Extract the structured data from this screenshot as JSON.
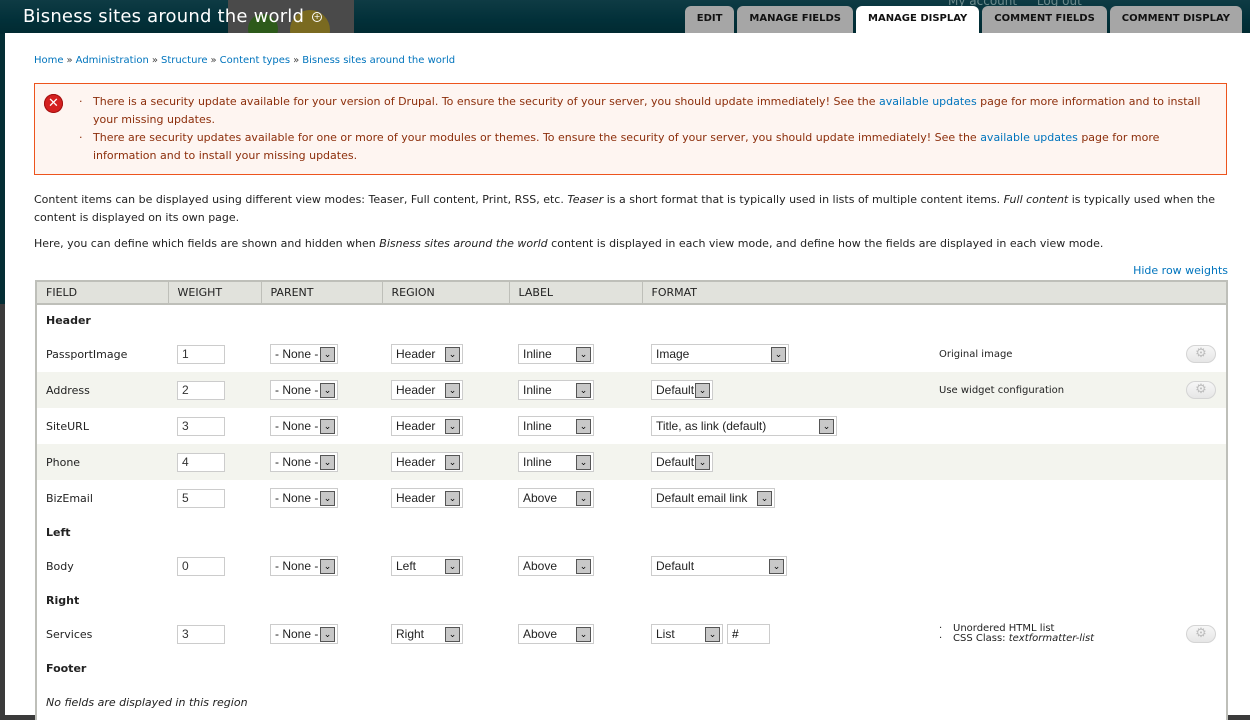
{
  "header": {
    "site_title": "Bisness sites around the world",
    "add_shortcut_icon": "plus-circle-icon",
    "account_links": [
      "My account",
      "Log out"
    ],
    "tabs": [
      {
        "label": "Edit",
        "active": false
      },
      {
        "label": "Manage fields",
        "active": false
      },
      {
        "label": "Manage display",
        "active": true
      },
      {
        "label": "Comment fields",
        "active": false
      },
      {
        "label": "Comment display",
        "active": false
      }
    ]
  },
  "breadcrumb": [
    "Home",
    "Administration",
    "Structure",
    "Content types",
    "Bisness sites around the world"
  ],
  "breadcrumb_sep": "»",
  "messages": {
    "icon": "error-icon",
    "items": [
      {
        "before": "There is a security update available for your version of Drupal. To ensure the security of your server, you should update immediately! See the ",
        "link": "available updates",
        "after": " page for more information and to install your missing updates."
      },
      {
        "before": "There are security updates available for one or more of your modules or themes. To ensure the security of your server, you should update immediately! See the ",
        "link": "available updates",
        "after": " page for more information and to install your missing updates."
      }
    ]
  },
  "intro": {
    "p1_a": "Content items can be displayed using different view modes: Teaser, Full content, Print, RSS, etc. ",
    "p1_em1": "Teaser",
    "p1_b": " is a short format that is typically used in lists of multiple content items. ",
    "p1_em2": "Full content",
    "p1_c": " is typically used when the content is displayed on its own page.",
    "p2_a": "Here, you can define which fields are shown and hidden when ",
    "p2_em": "Bisness sites around the world",
    "p2_b": " content is displayed in each view mode, and define how the fields are displayed in each view mode."
  },
  "hide_row_weights": "Hide row weights",
  "table": {
    "headers": [
      "Field",
      "Weight",
      "Parent",
      "Region",
      "Label",
      "Format"
    ],
    "regions": [
      {
        "name": "Header",
        "rows": [
          {
            "field": "PassportImage",
            "weight": "1",
            "parent": "- None -",
            "region": "Header",
            "label": "Inline",
            "format": "Image",
            "summary": [
              "Original image"
            ],
            "has_settings": true
          },
          {
            "field": "Address",
            "weight": "2",
            "parent": "- None -",
            "region": "Header",
            "label": "Inline",
            "format": "Default",
            "summary": [
              "Use widget configuration"
            ],
            "has_settings": true
          },
          {
            "field": "SiteURL",
            "weight": "3",
            "parent": "- None -",
            "region": "Header",
            "label": "Inline",
            "format": "Title, as link (default)",
            "summary": [],
            "has_settings": false
          },
          {
            "field": "Phone",
            "weight": "4",
            "parent": "- None -",
            "region": "Header",
            "label": "Inline",
            "format": "Default",
            "summary": [],
            "has_settings": false
          },
          {
            "field": "BizEmail",
            "weight": "5",
            "parent": "- None -",
            "region": "Header",
            "label": "Above",
            "format": "Default email link",
            "summary": [],
            "has_settings": false
          }
        ]
      },
      {
        "name": "Left",
        "rows": [
          {
            "field": "Body",
            "weight": "0",
            "parent": "- None -",
            "region": "Left",
            "label": "Above",
            "format": "Default",
            "summary": [],
            "has_settings": false
          }
        ]
      },
      {
        "name": "Right",
        "rows": [
          {
            "field": "Services",
            "weight": "3",
            "parent": "- None -",
            "region": "Right",
            "label": "Above",
            "format": "List",
            "format_extra": "#",
            "summary": [
              "Unordered HTML list",
              "CSS Class: |textformatter-list"
            ],
            "has_settings": true
          }
        ]
      },
      {
        "name": "Footer",
        "rows": [],
        "empty_text": "No fields are displayed in this region"
      }
    ]
  }
}
